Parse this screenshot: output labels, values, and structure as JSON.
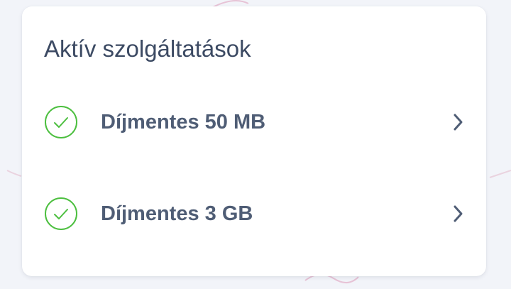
{
  "card": {
    "title": "Aktív szolgáltatások"
  },
  "services": [
    {
      "label": "Díjmentes 50 MB",
      "status_icon": "check-circle-icon",
      "action_icon": "chevron-right-icon"
    },
    {
      "label": "Díjmentes 3 GB",
      "status_icon": "check-circle-icon",
      "action_icon": "chevron-right-icon"
    }
  ],
  "colors": {
    "background": "#f2f4f9",
    "card": "#ffffff",
    "title": "#3c4a63",
    "label": "#4f5d75",
    "check": "#4cbf3f",
    "chevron": "#4f5d75"
  }
}
